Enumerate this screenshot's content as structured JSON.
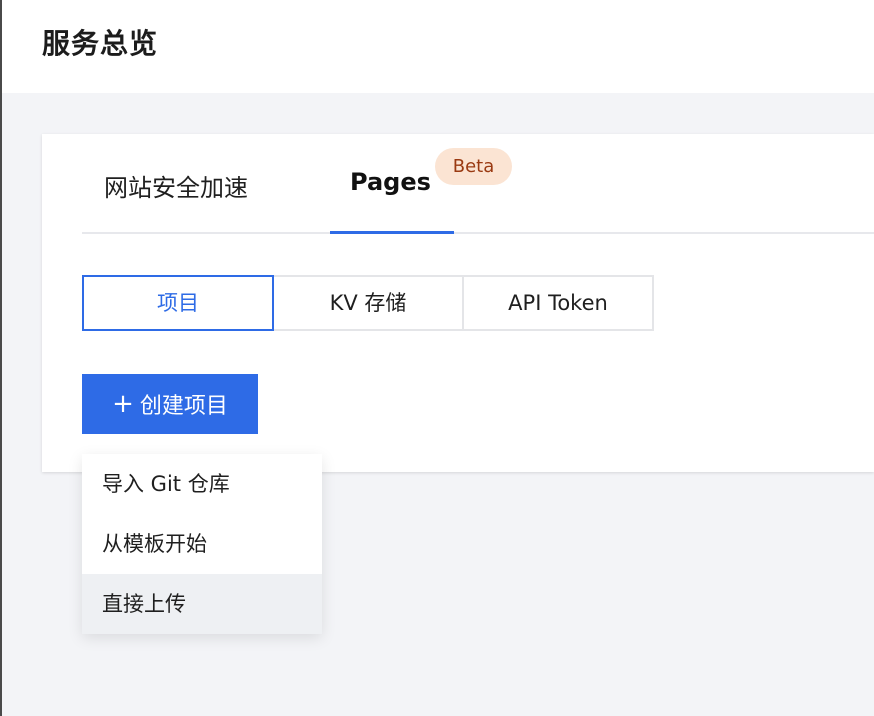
{
  "header": {
    "title": "服务总览"
  },
  "tabs": [
    {
      "label": "网站安全加速",
      "active": false
    },
    {
      "label": "Pages",
      "active": true,
      "badge": "Beta"
    }
  ],
  "segments": [
    {
      "label": "项目",
      "active": true
    },
    {
      "label": "KV 存储",
      "active": false
    },
    {
      "label": "API Token",
      "active": false
    }
  ],
  "create_button": {
    "icon": "plus-icon",
    "label": "创建项目"
  },
  "dropdown": {
    "items": [
      {
        "label": "导入 Git 仓库"
      },
      {
        "label": "从模板开始"
      },
      {
        "label": "直接上传",
        "hovered": true
      }
    ]
  },
  "colors": {
    "accent": "#2e6be6",
    "badge_bg": "#fbe4d3",
    "badge_text": "#9a3a12",
    "hover_bg": "#eef0f3"
  }
}
